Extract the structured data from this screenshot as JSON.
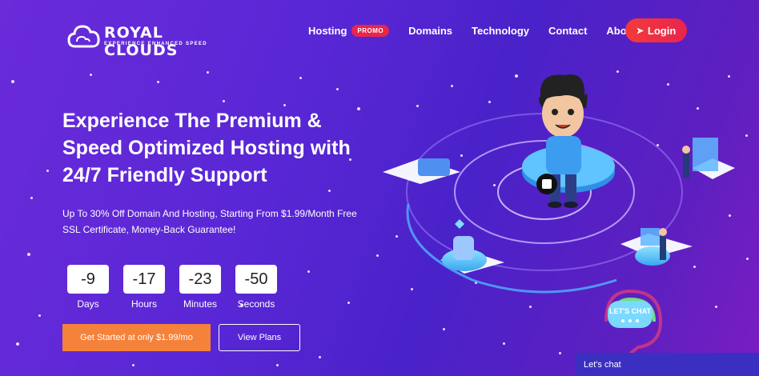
{
  "brand": {
    "name": "ROYAL CLOUDS",
    "tagline": "EXPERIENCE ENHANCED SPEED"
  },
  "nav": {
    "items": [
      {
        "label": "Hosting",
        "badge": "PROMO"
      },
      {
        "label": "Domains"
      },
      {
        "label": "Technology"
      },
      {
        "label": "Contact"
      },
      {
        "label": "About"
      }
    ],
    "login_label": "Login"
  },
  "hero": {
    "headline": "Experience The Premium & Speed Optimized Hosting with 24/7 Friendly Support",
    "subtext": "Up To 30% Off Domain And Hosting, Starting From $1.99/Month Free SSL Certificate, Money-Back Guarantee!",
    "countdown": [
      {
        "value": "-9",
        "label": "Days"
      },
      {
        "value": "-17",
        "label": "Hours"
      },
      {
        "value": "-23",
        "label": "Minutes"
      },
      {
        "value": "-50",
        "label": "Seconds"
      }
    ],
    "cta_primary": "Get Started at only $1.99/mo",
    "cta_secondary": "View Plans"
  },
  "chat": {
    "bubble_label": "LET'S CHAT",
    "bar_label": "Let's chat"
  },
  "colors": {
    "accent": "#e8254d",
    "cta": "#f5823a",
    "bg_start": "#6a2bd9",
    "bg_end": "#7a1ec2"
  }
}
